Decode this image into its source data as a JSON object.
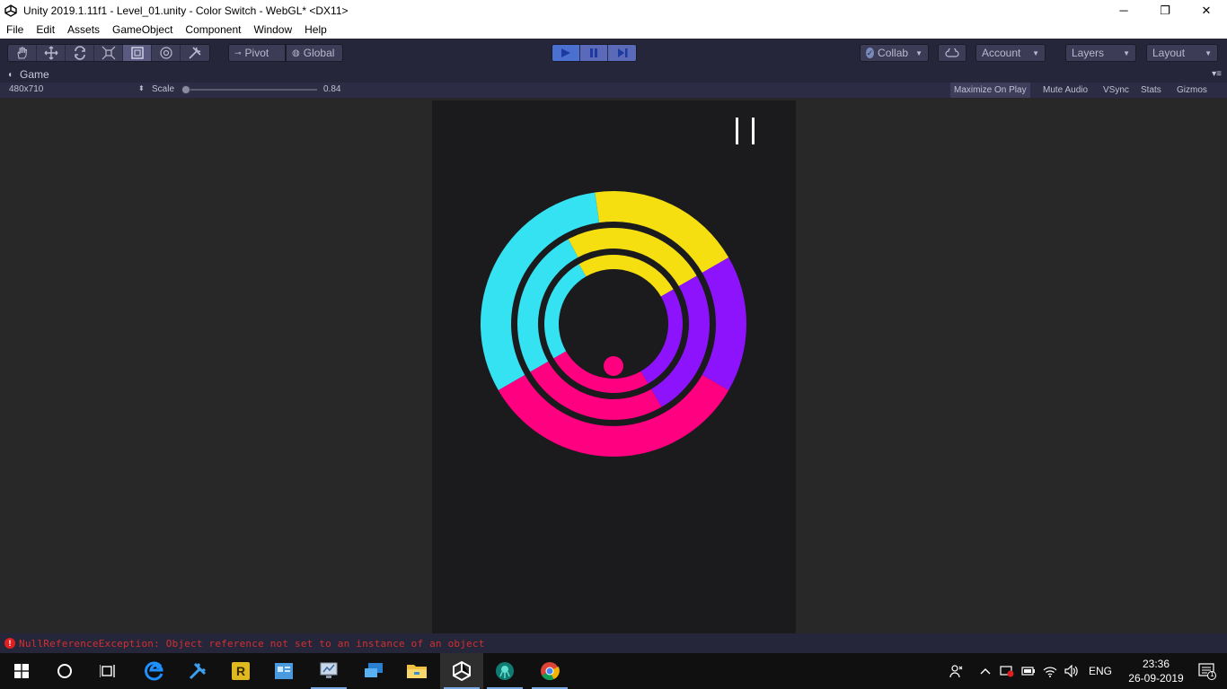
{
  "window": {
    "title": "Unity 2019.1.11f1 - Level_01.unity - Color Switch - WebGL* <DX11>",
    "minimize": "─",
    "maximize": "❐",
    "close": "✕"
  },
  "menu": [
    "File",
    "Edit",
    "Assets",
    "GameObject",
    "Component",
    "Window",
    "Help"
  ],
  "toolbar": {
    "pivot_label": "Pivot",
    "global_label": "Global",
    "collab_label": "Collab",
    "account_label": "Account",
    "layers_label": "Layers",
    "layout_label": "Layout"
  },
  "game_tab": {
    "label": "Game",
    "resolution": "480x710",
    "scale_label": "Scale",
    "scale_value": "0.84",
    "maximize_on_play": "Maximize On Play",
    "mute_audio": "Mute Audio",
    "vsync": "VSync",
    "stats": "Stats",
    "gizmos": "Gizmos"
  },
  "game": {
    "colors": {
      "cyan": "#35e2f2",
      "yellow": "#f5df11",
      "purple": "#8c13fb",
      "magenta": "#ff0080",
      "background": "#1b1b1d",
      "ball": "#ff0080"
    }
  },
  "console": {
    "error_message": "NullReferenceException: Object reference not set to an instance of an object"
  },
  "taskbar": {
    "language": "ENG",
    "time": "23:36",
    "date": "26-09-2019",
    "notification_count": "1"
  }
}
